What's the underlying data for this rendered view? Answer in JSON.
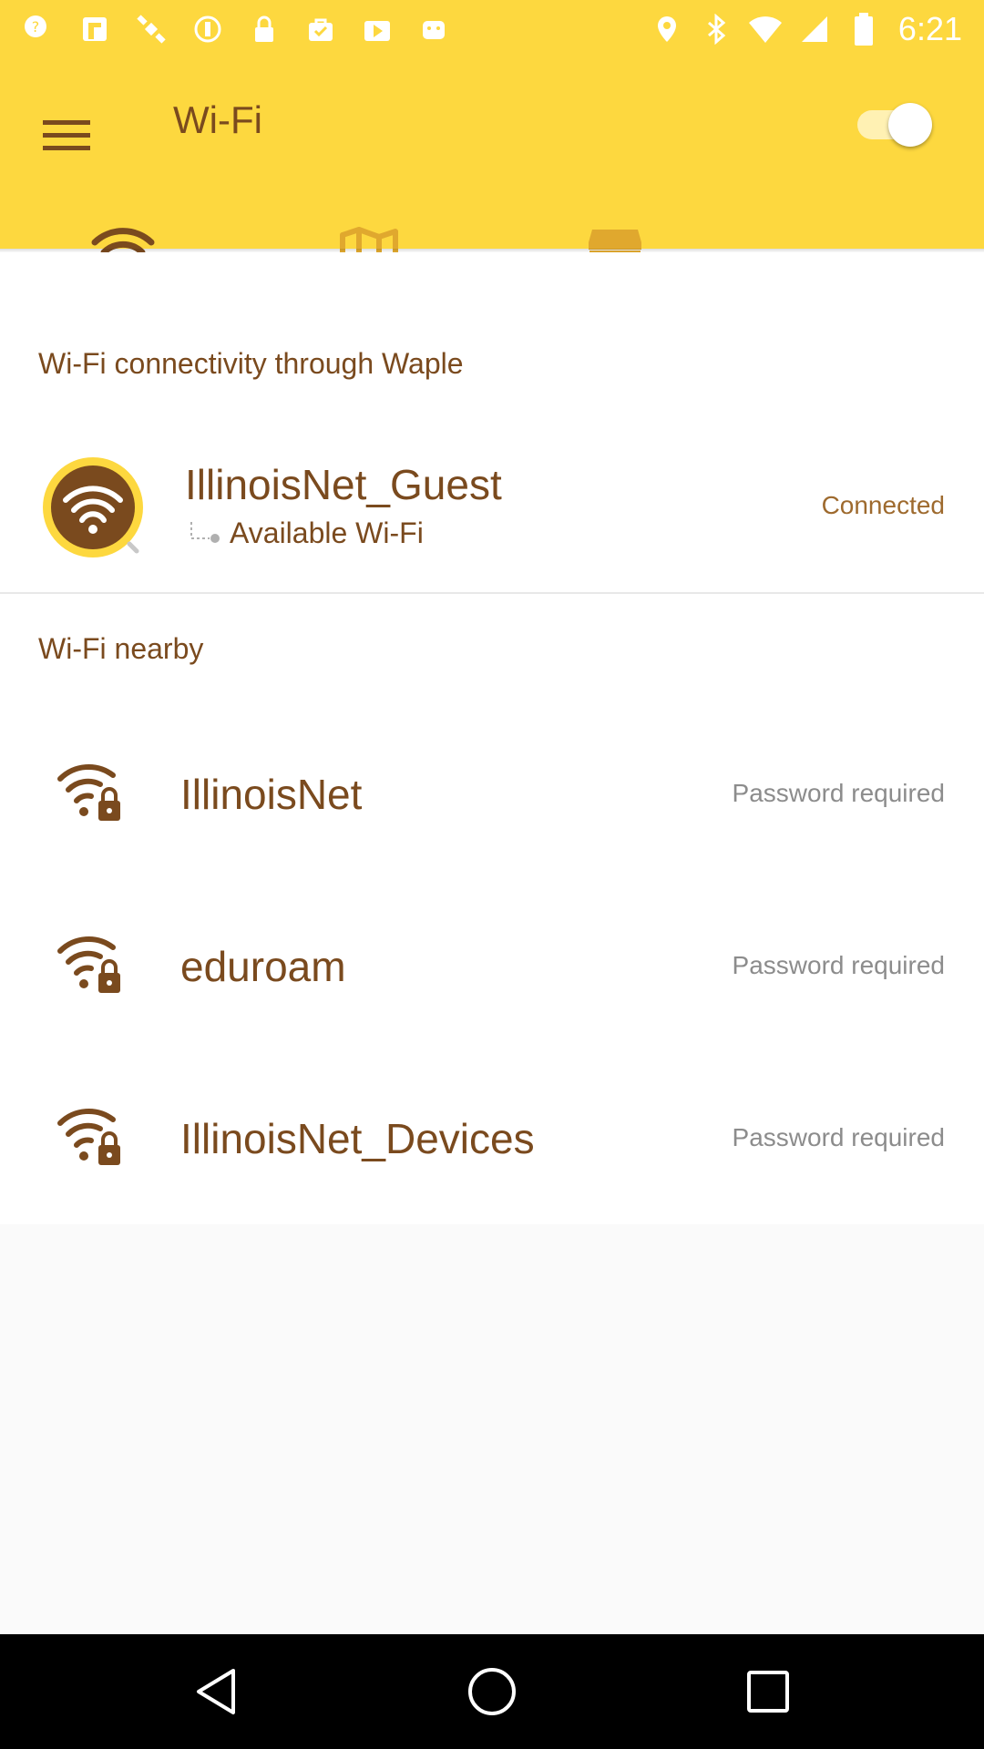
{
  "status_bar": {
    "time": "6:21",
    "left_icons": [
      "help-icon",
      "fantasy-icon",
      "satellite-icon",
      "pinwheel-icon",
      "lock-icon",
      "shopping-bag-icon",
      "play-store-icon",
      "android-icon"
    ],
    "right_icons": [
      "location-icon",
      "bluetooth-icon",
      "wifi-signal-icon",
      "cell-signal-icon",
      "battery-icon"
    ]
  },
  "app_bar": {
    "title": "Wi-Fi",
    "toggle_on": true,
    "tabs": [
      {
        "icon": "wifi-icon",
        "active": true
      },
      {
        "icon": "map-icon",
        "active": false
      },
      {
        "icon": "store-icon",
        "active": false
      }
    ]
  },
  "connected_section": {
    "title": "Wi-Fi connectivity through Waple",
    "network": {
      "name": "IllinoisNet_Guest",
      "subtitle": "Available Wi-Fi",
      "status": "Connected"
    }
  },
  "nearby_section": {
    "title": "Wi-Fi nearby",
    "networks": [
      {
        "name": "IllinoisNet",
        "status": "Password required"
      },
      {
        "name": "eduroam",
        "status": "Password required"
      },
      {
        "name": "IllinoisNet_Devices",
        "status": "Password required"
      }
    ]
  },
  "colors": {
    "accent_yellow": "#FDD83F",
    "brown": "#7A4A1E",
    "indicator": "#9E6A2E"
  }
}
